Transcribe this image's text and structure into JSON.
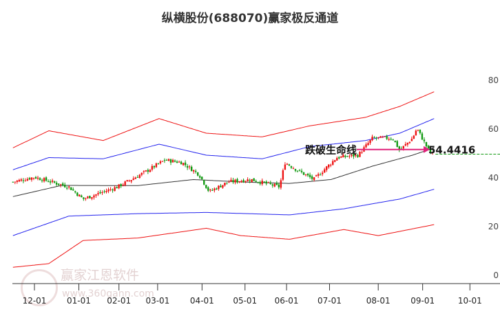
{
  "chart_data": {
    "type": "candlestick",
    "title": "纵横股份(688070)赢家极反通道",
    "x_unit": "days since 12-01",
    "x_ticks": [
      {
        "label": "12-01",
        "day": 0
      },
      {
        "label": "01-01",
        "day": 31
      },
      {
        "label": "02-01",
        "day": 59
      },
      {
        "label": "03-01",
        "day": 86
      },
      {
        "label": "04-01",
        "day": 117
      },
      {
        "label": "05-01",
        "day": 147
      },
      {
        "label": "06-01",
        "day": 176
      },
      {
        "label": "07-01",
        "day": 206
      },
      {
        "label": "08-01",
        "day": 240
      },
      {
        "label": "09-01",
        "day": 271
      },
      {
        "label": "10-01",
        "day": 304
      }
    ],
    "y_ticks": [
      0,
      20,
      40,
      60,
      80
    ],
    "ylim": [
      0,
      82
    ],
    "price_keypoints": [
      [
        -15,
        40
      ],
      [
        0,
        42
      ],
      [
        24,
        38
      ],
      [
        34,
        33
      ],
      [
        58,
        38
      ],
      [
        77,
        44
      ],
      [
        91,
        49
      ],
      [
        103,
        48
      ],
      [
        115,
        43
      ],
      [
        122,
        36
      ],
      [
        135,
        40
      ],
      [
        151,
        41
      ],
      [
        171,
        38
      ],
      [
        175,
        48
      ],
      [
        183,
        45
      ],
      [
        195,
        41
      ],
      [
        211,
        50
      ],
      [
        226,
        51
      ],
      [
        236,
        58
      ],
      [
        250,
        58
      ],
      [
        255,
        53
      ],
      [
        264,
        58
      ],
      [
        267,
        62
      ],
      [
        276,
        52
      ],
      [
        279,
        51.5
      ]
    ],
    "series": [
      {
        "name": "mid",
        "color": "#333333",
        "points": [
          [
            -15,
            34
          ],
          [
            19,
            38.6
          ],
          [
            72,
            38.5
          ],
          [
            111,
            41
          ],
          [
            144,
            40
          ],
          [
            178,
            39.4
          ],
          [
            207,
            41
          ],
          [
            236,
            46.5
          ],
          [
            264,
            51
          ],
          [
            279,
            54
          ]
        ]
      },
      {
        "name": "upper-blue",
        "color": "#2222ee",
        "points": [
          [
            -15,
            45
          ],
          [
            10,
            50
          ],
          [
            48,
            49.5
          ],
          [
            87,
            55.5
          ],
          [
            120,
            51
          ],
          [
            159,
            49.5
          ],
          [
            192,
            54.5
          ],
          [
            231,
            57
          ],
          [
            255,
            60
          ],
          [
            279,
            66
          ]
        ]
      },
      {
        "name": "lower-blue",
        "color": "#2222ee",
        "points": [
          [
            -15,
            18
          ],
          [
            24,
            26
          ],
          [
            72,
            27
          ],
          [
            120,
            27.5
          ],
          [
            178,
            26.5
          ],
          [
            216,
            29
          ],
          [
            255,
            33
          ],
          [
            279,
            37
          ]
        ]
      },
      {
        "name": "upper-red",
        "color": "#ee1111",
        "points": [
          [
            -15,
            54
          ],
          [
            10,
            61
          ],
          [
            48,
            57
          ],
          [
            87,
            66
          ],
          [
            120,
            60
          ],
          [
            159,
            58.5
          ],
          [
            192,
            63
          ],
          [
            231,
            66.5
          ],
          [
            255,
            71
          ],
          [
            279,
            77
          ]
        ]
      },
      {
        "name": "lower-red",
        "color": "#ee1111",
        "points": [
          [
            -15,
            5
          ],
          [
            10,
            6.5
          ],
          [
            34,
            16
          ],
          [
            72,
            17
          ],
          [
            120,
            21
          ],
          [
            144,
            18
          ],
          [
            178,
            16.5
          ],
          [
            216,
            20.5
          ],
          [
            240,
            18
          ],
          [
            279,
            22.5
          ]
        ]
      }
    ],
    "annotation": {
      "text": "跌破生命线",
      "value": "54.4416",
      "value_num": 54.4416,
      "arrow_color": "#e0207a"
    },
    "last_price_line": 51.4
  },
  "watermark": {
    "name": "赢家江恩软件",
    "url": "www.360gann.com"
  }
}
